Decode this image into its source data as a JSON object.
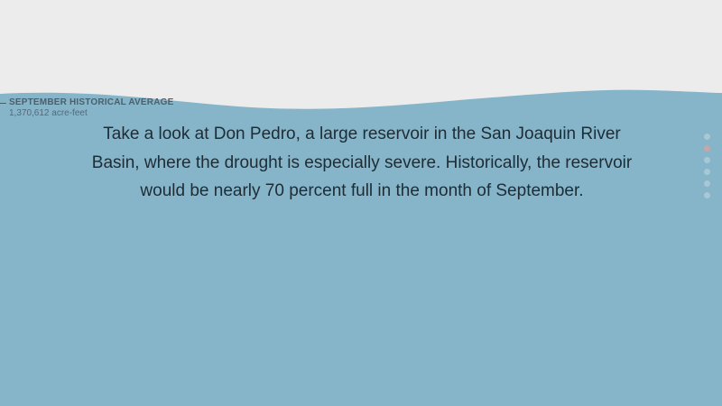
{
  "reservoir_level": {
    "label": "SEPTEMBER HISTORICAL AVERAGE",
    "value": "1,370,612 acre-feet"
  },
  "narrative": {
    "text": "Take a look at Don Pedro, a large reservoir in the San Joaquin River Basin, where the drought is especially severe. Historically, the reservoir would be nearly 70 percent full in the month of September."
  },
  "progress": {
    "total_steps": 6,
    "current_step": 2
  },
  "colors": {
    "sky": "#ececec",
    "water": "#86b5ca",
    "text": "#1e2c35",
    "label": "#4b5f6b",
    "dot_inactive": "#a7c8d6",
    "dot_active": "#c9a6a6"
  }
}
